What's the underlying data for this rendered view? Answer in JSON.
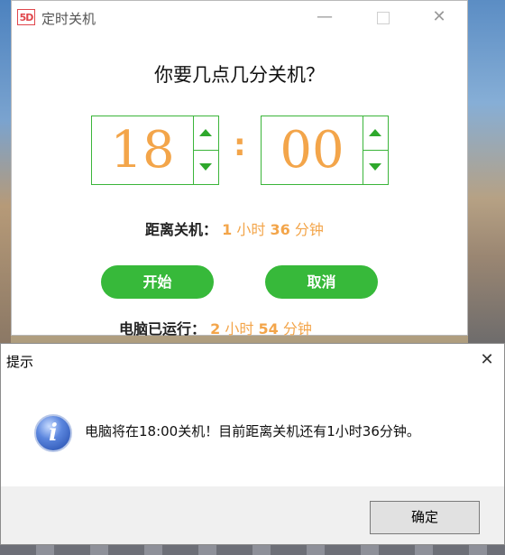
{
  "app": {
    "logo_text": "5D",
    "title": "定时关机",
    "question": "你要几点几分关机？",
    "hour": "18",
    "minute": "00",
    "separator": ":",
    "remaining": {
      "label": "距离关机：",
      "hours": "1",
      "hours_unit": "小时",
      "minutes": "36",
      "minutes_unit": "分钟"
    },
    "start_label": "开始",
    "cancel_label": "取消",
    "runtime": {
      "label": "电脑已运行：",
      "hours": "2",
      "hours_unit": "小时",
      "minutes": "54",
      "minutes_unit": "分钟"
    },
    "accent_color": "#37b93a",
    "number_color": "#f3a54a"
  },
  "dialog": {
    "title": "提示",
    "message": "电脑将在18:00关机！目前距离关机还有1小时36分钟。",
    "ok_label": "确定",
    "icon": "info-icon"
  }
}
